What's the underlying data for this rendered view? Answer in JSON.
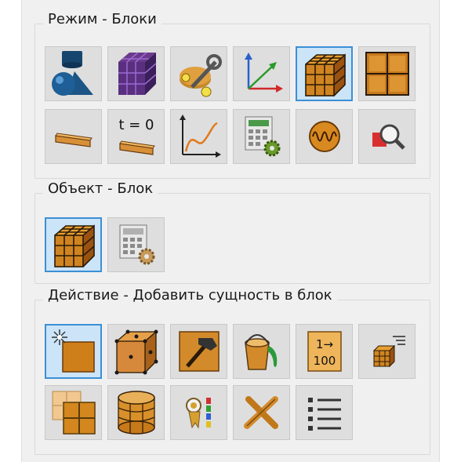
{
  "sections": {
    "mode": {
      "title": "Режим - Блоки"
    },
    "object": {
      "title": "Объект - Блок"
    },
    "action": {
      "title": "Действие - Добавить сущность в блок"
    }
  },
  "icons": {
    "mode_row1": [
      "geometry-icon",
      "mesh-icon",
      "assembly-icon",
      "coordinate-system-icon",
      "block-icon",
      "grid-icon"
    ],
    "mode_row2": [
      "material-icon",
      "initial-condition-icon",
      "chart-icon",
      "calculator-settings-icon",
      "oscilloscope-icon",
      "inspect-icon"
    ],
    "object_row": [
      "block-icon",
      "calculator-settings-icon"
    ],
    "action_row1": [
      "add-entity-icon",
      "node-cube-icon",
      "hammer-icon",
      "paint-bucket-icon",
      "numbering-icon",
      "block-list-icon"
    ],
    "action_row2": [
      "tile-layout-icon",
      "cylinder-icon",
      "properties-icon",
      "tools-icon",
      "list-icon"
    ],
    "numbering_text": [
      "1→",
      "100"
    ],
    "initial_condition_text": "t = 0"
  },
  "selected": {
    "mode": "block-icon",
    "object": "block-icon",
    "action": "add-entity-icon"
  },
  "colors": {
    "active_bg": "#cce4f7",
    "active_border": "#3b8fd6",
    "button_bg": "#dedede",
    "orange": "#d98a1c",
    "dark_orange": "#a0560e"
  }
}
